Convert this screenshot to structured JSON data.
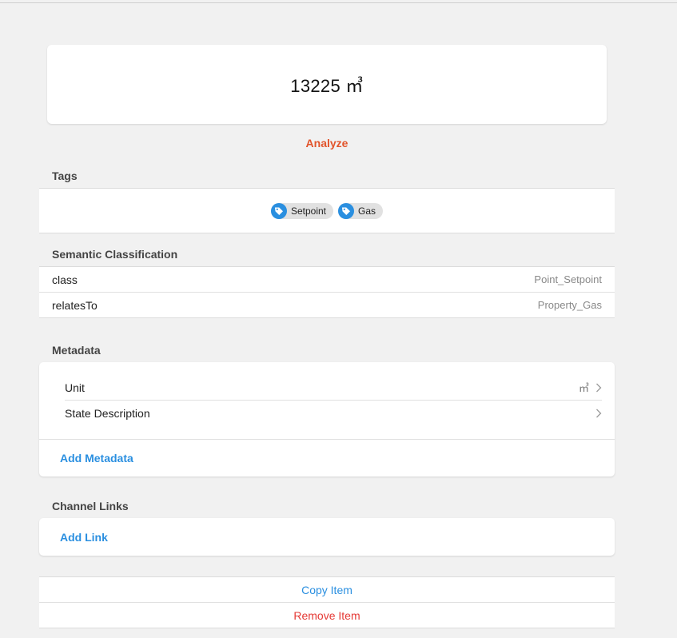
{
  "state": {
    "value": "13225 ㎥"
  },
  "analyze_label": "Analyze",
  "tags": {
    "title": "Tags",
    "items": [
      {
        "label": "Setpoint",
        "icon": "tag-icon"
      },
      {
        "label": "Gas",
        "icon": "tag-icon"
      }
    ]
  },
  "semantic": {
    "title": "Semantic Classification",
    "rows": [
      {
        "key": "class",
        "value": "Point_Setpoint"
      },
      {
        "key": "relatesTo",
        "value": "Property_Gas"
      }
    ]
  },
  "metadata": {
    "title": "Metadata",
    "rows": [
      {
        "label": "Unit",
        "value": "㎥"
      },
      {
        "label": "State Description",
        "value": ""
      }
    ],
    "add_label": "Add Metadata"
  },
  "channel_links": {
    "title": "Channel Links",
    "add_label": "Add Link"
  },
  "actions": {
    "copy_label": "Copy Item",
    "remove_label": "Remove Item"
  },
  "colors": {
    "accent": "#2a8fe0",
    "analyze": "#e2542b",
    "danger": "#e53935",
    "background": "#f1f1f1"
  }
}
